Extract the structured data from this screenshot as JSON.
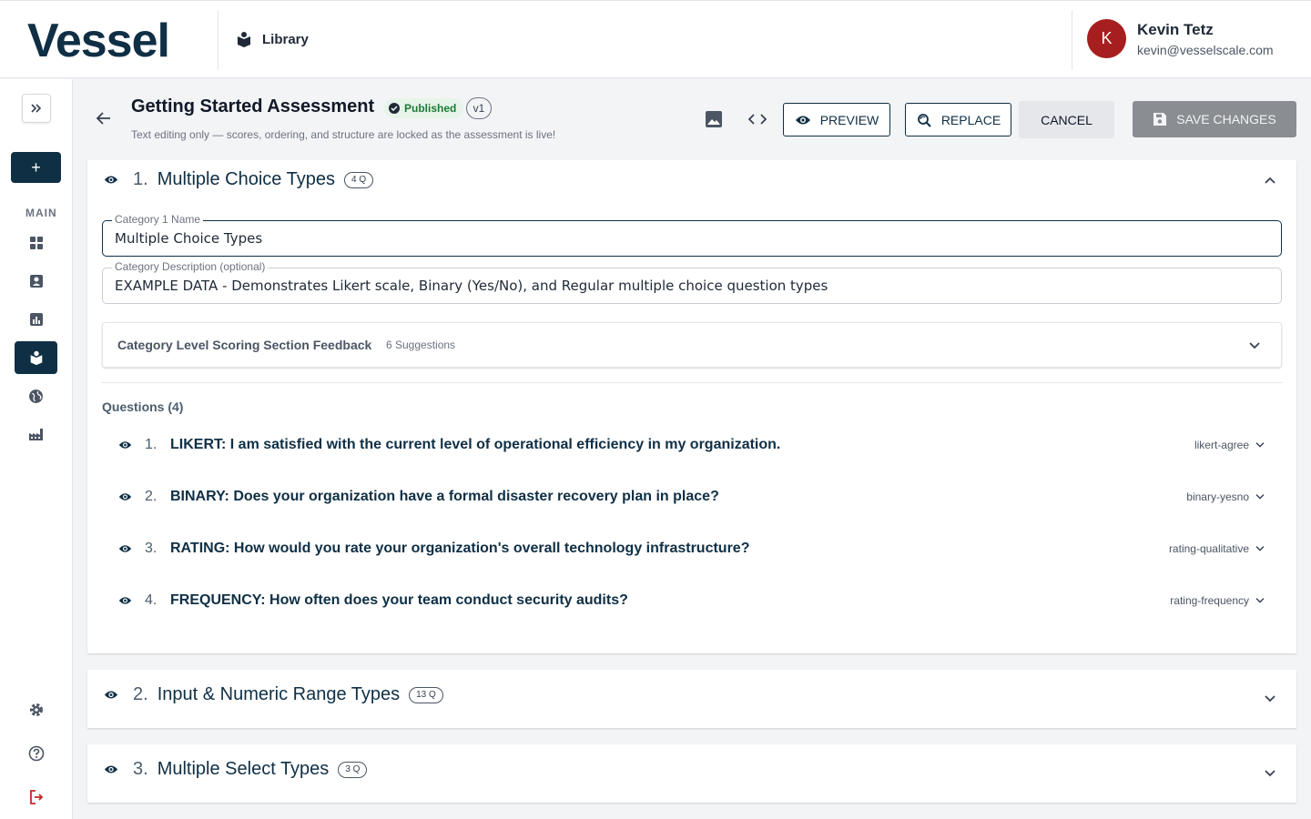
{
  "brand": {
    "logo": "Vessel"
  },
  "topbar": {
    "section_label": "Library"
  },
  "user": {
    "initial": "K",
    "name": "Kevin Tetz",
    "email": "kevin@vesselscale.com"
  },
  "sidebar": {
    "add_label": "+",
    "section_label": "MAIN"
  },
  "assessment": {
    "title": "Getting Started Assessment",
    "status": "Published",
    "version": "v1",
    "subtitle": "Text editing only — scores, ordering, and structure are locked as the assessment is live!"
  },
  "actions": {
    "preview": "PREVIEW",
    "replace": "REPLACE",
    "cancel": "CANCEL",
    "save": "SAVE CHANGES"
  },
  "categories": [
    {
      "number": "1.",
      "title": "Multiple Choice Types",
      "count": "4 Q",
      "name_label": "Category 1 Name",
      "name_value": "Multiple Choice Types",
      "desc_label": "Category Description (optional)",
      "desc_value": "EXAMPLE DATA - Demonstrates Likert scale, Binary (Yes/No), and Regular multiple choice question types",
      "feedback_title": "Category Level Scoring Section Feedback",
      "feedback_count": "6 Suggestions",
      "questions_header": "Questions (4)",
      "questions": [
        {
          "number": "1.",
          "text": "LIKERT: I am satisfied with the current level of operational efficiency in my organization.",
          "type": "likert-agree"
        },
        {
          "number": "2.",
          "text": "BINARY: Does your organization have a formal disaster recovery plan in place?",
          "type": "binary-yesno"
        },
        {
          "number": "3.",
          "text": "RATING: How would you rate your organization's overall technology infrastructure?",
          "type": "rating-qualitative"
        },
        {
          "number": "4.",
          "text": "FREQUENCY: How often does your team conduct security audits?",
          "type": "rating-frequency"
        }
      ]
    },
    {
      "number": "2.",
      "title": "Input & Numeric Range Types",
      "count": "13 Q"
    },
    {
      "number": "3.",
      "title": "Multiple Select Types",
      "count": "3 Q"
    }
  ],
  "colors": {
    "primary": "#0f2f45",
    "published_bg": "#e6f4ea",
    "published_text": "#1e7a35",
    "avatar": "#a61e1e",
    "logout": "#c62828"
  }
}
